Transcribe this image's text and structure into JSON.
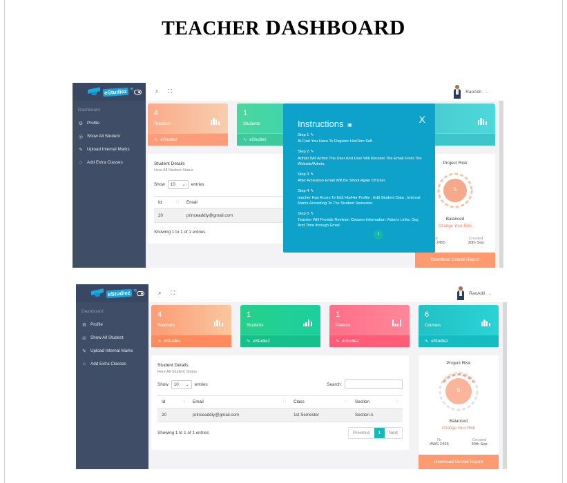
{
  "document": {
    "title_part1": "TEACHER",
    "title_part2": "DASHBOARD"
  },
  "app": {
    "logo_text": "eStudiez",
    "user_name": "RaoAdil",
    "sidebar": {
      "caption": "Dashboard",
      "items": [
        {
          "label": "Profile",
          "icon": "gear-icon"
        },
        {
          "label": "Show All Student",
          "icon": "circle-icon"
        },
        {
          "label": "Upload Internal Marks",
          "icon": "edit-icon"
        },
        {
          "label": "Add Extra Classes",
          "icon": "home-icon"
        }
      ]
    },
    "cards": [
      {
        "value": "4",
        "label": "Teachers",
        "footer": "eStudiez",
        "color": "#fd9b73"
      },
      {
        "value": "1",
        "label": "Students",
        "footer": "eStudiez",
        "color": "#26d08a"
      },
      {
        "value": "1",
        "label": "Parents",
        "footer": "eStudiez",
        "color": "#ff6f86"
      },
      {
        "value": "6",
        "label": "Courses",
        "footer": "eStudiez",
        "color": "#21c1c4"
      }
    ],
    "student_details": {
      "title": "Student Details",
      "subtitle": "Here All Student Status",
      "show_label": "Show",
      "entries_value": "10",
      "entries_label": "entries",
      "search_label": "Search:",
      "columns": [
        "Id",
        "Email",
        "Class",
        "Section"
      ],
      "rows": [
        {
          "id": "20",
          "email": "princeaddiy@gmail.com",
          "class": "1st Semester",
          "section": "Section A"
        }
      ],
      "info": "Showing 1 to 1 of 1 entries",
      "pager": {
        "previous": "Previous",
        "page": "1",
        "next": "Next"
      }
    },
    "risk": {
      "title": "Project Risk",
      "value": "5",
      "status": "Balanced",
      "link": "Change Your Risk",
      "nr_label": "Nr",
      "nr_value": "AWS 2455",
      "created_label": "Created",
      "created_value": "30th Sep",
      "report_button": "Download Overall Report"
    },
    "modal": {
      "title": "Instructions",
      "close": "X",
      "steps": [
        {
          "heading": "Step 1",
          "text": "At First You Have To Register Her/Him Self."
        },
        {
          "heading": "Step 2",
          "text": "Admin Will Active The User And User Will Receive The Email From The Website/Admin."
        },
        {
          "heading": "Step 3",
          "text": "After Activation Email Will Be Shoot Again Of User."
        },
        {
          "heading": "Step 4",
          "text": "teacher Has Acces To Edit His/Her Profile , Edit Student Data , Internal Marks According To The Student Semester."
        },
        {
          "heading": "Step 5",
          "text": "Teacher Will Provide Revision Classes Information Video's Links, Day And Time through Email."
        }
      ],
      "badge": "1"
    }
  }
}
